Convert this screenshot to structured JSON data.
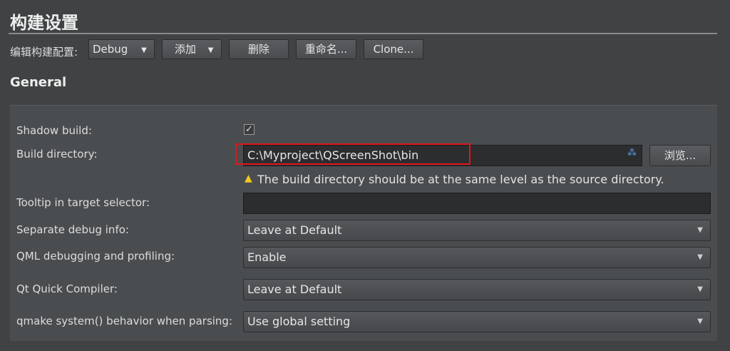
{
  "header": {
    "title": "构建设置"
  },
  "toolbar": {
    "config_label": "编辑构建配置:",
    "config_value": "Debug",
    "add_label": "添加",
    "delete_label": "删除",
    "rename_label": "重命名...",
    "clone_label": "Clone..."
  },
  "section": {
    "title": "General"
  },
  "form": {
    "shadow_build": {
      "label": "Shadow build:",
      "checked": true,
      "check_glyph": "✓"
    },
    "build_directory": {
      "label": "Build directory:",
      "value": "C:\\Myproject\\QScreenShot\\bin",
      "browse_label": "浏览...",
      "warning": "The build directory should be at the same level as the source directory."
    },
    "tooltip": {
      "label": "Tooltip in target selector:",
      "value": ""
    },
    "separate_debug": {
      "label": "Separate debug info:",
      "value": "Leave at Default"
    },
    "qml_debugging": {
      "label": "QML debugging and profiling:",
      "value": "Enable"
    },
    "qt_quick_compiler": {
      "label": "Qt Quick Compiler:",
      "value": "Leave at Default"
    },
    "qmake_system": {
      "label": "qmake system() behavior when parsing:",
      "value": "Use global setting"
    }
  },
  "icons": {
    "dropdown": "chevron-down-icon",
    "warning": "warning-icon",
    "dir_variables": "variables-icon"
  },
  "colors": {
    "highlight_border": "#e0161c",
    "warning": "#f3c623",
    "background": "#404244"
  }
}
